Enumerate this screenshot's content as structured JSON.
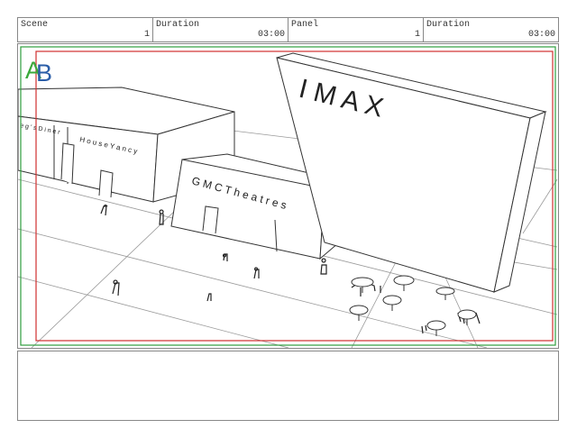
{
  "header": {
    "scene_label": "Scene",
    "scene_value": "1",
    "scene_duration_label": "Duration",
    "scene_duration_value": "03:00",
    "panel_label": "Panel",
    "panel_value": "1",
    "panel_duration_label": "Duration",
    "panel_duration_value": "03:00"
  },
  "sketch": {
    "logo_a": "A",
    "logo_b": "B",
    "sign_imax": "I M A X",
    "sign_gmc": "G M C   T h e a t r e s",
    "sign_house": "H o u s e   Y a n c y",
    "sign_diner": "e g ' s   D i n e r"
  },
  "notes": {
    "text": ""
  },
  "colors": {
    "safe_green": "#2e9e3e",
    "safe_red": "#d03030",
    "line": "#333333"
  }
}
